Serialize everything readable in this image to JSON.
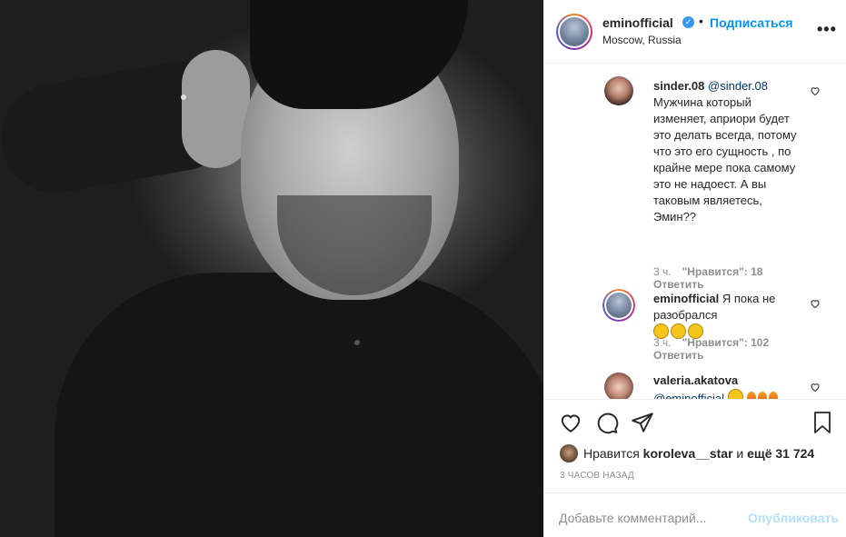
{
  "post": {
    "username": "eminofficial",
    "verified_icon": "verified-badge-icon",
    "separator": "•",
    "follow_label": "Подписаться",
    "location": "Moscow, Russia",
    "more_label": "•••"
  },
  "comments": [
    {
      "username": "sinder.08",
      "mention": "@sinder.08",
      "text": "Мужчина который изменяет, априори будет это делать всегда, потому что это его сущность , по крайне мере пока самому это не надоест. А вы таковым являетесь, Эмин??",
      "time": "3 ч.",
      "likes": "\"Нравится\": 18",
      "reply": "Ответить"
    },
    {
      "username": "eminofficial",
      "text": "Я пока не разобрался",
      "time": "3 ч.",
      "likes": "\"Нравится\": 102",
      "reply": "Ответить"
    },
    {
      "username": "valeria.akatova",
      "mention": "@eminofficial"
    }
  ],
  "liked_by": {
    "prefix": "Нравится",
    "user": "koroleva__star",
    "middle": "и",
    "rest": "ещё 31 724"
  },
  "timestamp": "3 ЧАСОВ НАЗАД",
  "add_comment": {
    "placeholder": "Добавьте комментарий...",
    "publish": "Опубликовать"
  },
  "colors": {
    "link": "#0095f6",
    "text": "#262626",
    "muted": "#8e8e8e",
    "publish_disabled": "#b2dffc"
  }
}
